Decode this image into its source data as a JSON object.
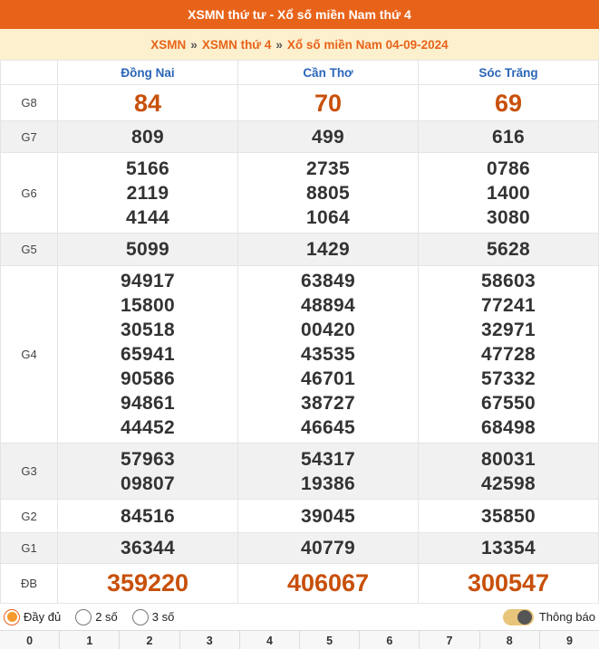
{
  "header": {
    "title": "XSMN thứ tư - Xổ số miền Nam thứ 4"
  },
  "breadcrumb": {
    "item1": "XSMN",
    "sep1": "»",
    "item2": "XSMN thứ 4",
    "sep2": "»",
    "item3": "Xổ số miền Nam 04-09-2024"
  },
  "provinces": [
    "Đồng Nai",
    "Cần Thơ",
    "Sóc Trăng"
  ],
  "prizes": {
    "g8": {
      "label": "G8",
      "values": [
        [
          "84"
        ],
        [
          "70"
        ],
        [
          "69"
        ]
      ]
    },
    "g7": {
      "label": "G7",
      "values": [
        [
          "809"
        ],
        [
          "499"
        ],
        [
          "616"
        ]
      ]
    },
    "g6": {
      "label": "G6",
      "values": [
        [
          "5166",
          "2119",
          "4144"
        ],
        [
          "2735",
          "8805",
          "1064"
        ],
        [
          "0786",
          "1400",
          "3080"
        ]
      ]
    },
    "g5": {
      "label": "G5",
      "values": [
        [
          "5099"
        ],
        [
          "1429"
        ],
        [
          "5628"
        ]
      ]
    },
    "g4": {
      "label": "G4",
      "values": [
        [
          "94917",
          "15800",
          "30518",
          "65941",
          "90586",
          "94861",
          "44452"
        ],
        [
          "63849",
          "48894",
          "00420",
          "43535",
          "46701",
          "38727",
          "46645"
        ],
        [
          "58603",
          "77241",
          "32971",
          "47728",
          "57332",
          "67550",
          "68498"
        ]
      ]
    },
    "g3": {
      "label": "G3",
      "values": [
        [
          "57963",
          "09807"
        ],
        [
          "54317",
          "19386"
        ],
        [
          "80031",
          "42598"
        ]
      ]
    },
    "g2": {
      "label": "G2",
      "values": [
        [
          "84516"
        ],
        [
          "39045"
        ],
        [
          "35850"
        ]
      ]
    },
    "g1": {
      "label": "G1",
      "values": [
        [
          "36344"
        ],
        [
          "40779"
        ],
        [
          "13354"
        ]
      ]
    },
    "db": {
      "label": "ĐB",
      "values": [
        [
          "359220"
        ],
        [
          "406067"
        ],
        [
          "300547"
        ]
      ]
    }
  },
  "controls": {
    "options": [
      "Đầy đủ",
      "2 số",
      "3 số"
    ],
    "selected": "Đầy đủ",
    "notify_label": "Thông báo"
  },
  "digits": [
    "0",
    "1",
    "2",
    "3",
    "4",
    "5",
    "6",
    "7",
    "8",
    "9"
  ],
  "colors": {
    "accent": "#e8631a",
    "breadcrumb_bg": "#fdf0cf",
    "province": "#2b66b8",
    "special": "#c8500a"
  }
}
